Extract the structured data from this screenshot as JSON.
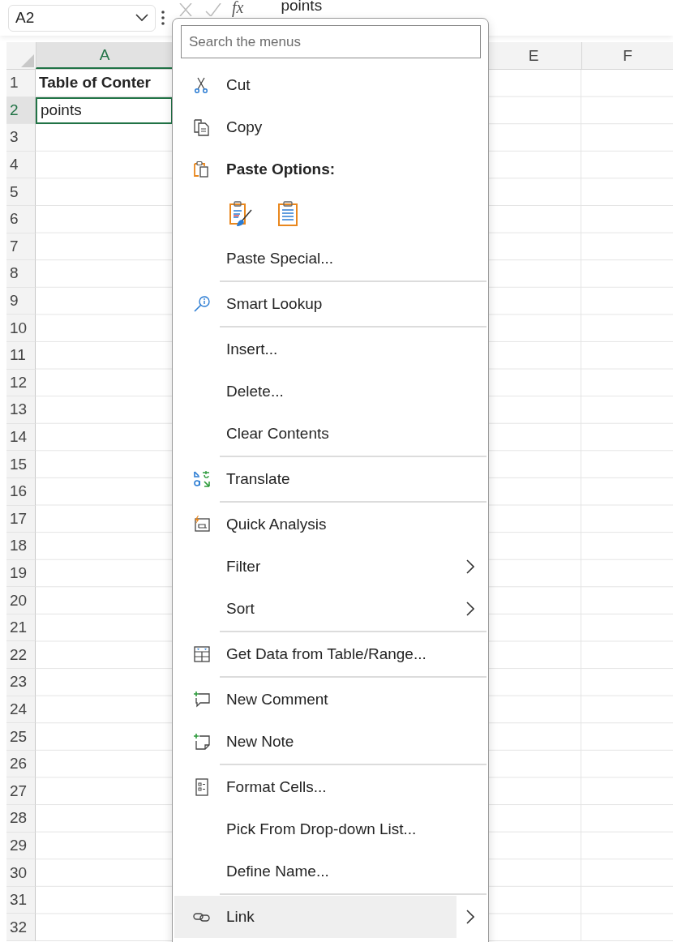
{
  "name_box": {
    "value": "A2"
  },
  "formula_bar": {
    "function_label": "fx",
    "value": "points"
  },
  "columns": [
    {
      "label": "A",
      "selected": true
    },
    {
      "label": "E",
      "selected": false
    },
    {
      "label": "F",
      "selected": false
    }
  ],
  "rows": [
    {
      "number": "1",
      "selected": false,
      "cell": {
        "text": "Table of Conter",
        "bold": true
      }
    },
    {
      "number": "2",
      "selected": true,
      "cell": {
        "text": "points",
        "bold": false
      }
    },
    {
      "number": "3",
      "selected": false
    },
    {
      "number": "4",
      "selected": false
    },
    {
      "number": "5",
      "selected": false
    },
    {
      "number": "6",
      "selected": false
    },
    {
      "number": "7",
      "selected": false
    },
    {
      "number": "8",
      "selected": false
    },
    {
      "number": "9",
      "selected": false
    },
    {
      "number": "10",
      "selected": false
    },
    {
      "number": "11",
      "selected": false
    },
    {
      "number": "12",
      "selected": false
    },
    {
      "number": "13",
      "selected": false
    },
    {
      "number": "14",
      "selected": false
    },
    {
      "number": "15",
      "selected": false
    },
    {
      "number": "16",
      "selected": false
    },
    {
      "number": "17",
      "selected": false
    },
    {
      "number": "18",
      "selected": false
    },
    {
      "number": "19",
      "selected": false
    },
    {
      "number": "20",
      "selected": false
    },
    {
      "number": "21",
      "selected": false
    },
    {
      "number": "22",
      "selected": false
    },
    {
      "number": "23",
      "selected": false
    },
    {
      "number": "24",
      "selected": false
    },
    {
      "number": "25",
      "selected": false
    },
    {
      "number": "26",
      "selected": false
    },
    {
      "number": "27",
      "selected": false
    },
    {
      "number": "28",
      "selected": false
    },
    {
      "number": "29",
      "selected": false
    },
    {
      "number": "30",
      "selected": false
    },
    {
      "number": "31",
      "selected": false
    },
    {
      "number": "32",
      "selected": false
    }
  ],
  "context_menu": {
    "search": {
      "placeholder": "Search the menus"
    },
    "items": [
      {
        "kind": "item",
        "label": "Cut",
        "submenu": false,
        "selected": false
      },
      {
        "kind": "item",
        "label": "Copy",
        "submenu": false,
        "selected": false
      },
      {
        "kind": "header",
        "label": "Paste Options:"
      },
      {
        "kind": "paste-icons"
      },
      {
        "kind": "item",
        "label": "Paste Special...",
        "submenu": false,
        "selected": false
      },
      {
        "kind": "separator"
      },
      {
        "kind": "item",
        "label": "Smart Lookup",
        "submenu": false,
        "selected": false
      },
      {
        "kind": "separator"
      },
      {
        "kind": "item",
        "label": "Insert...",
        "submenu": false,
        "selected": false
      },
      {
        "kind": "item",
        "label": "Delete...",
        "submenu": false,
        "selected": false
      },
      {
        "kind": "item",
        "label": "Clear Contents",
        "submenu": false,
        "selected": false
      },
      {
        "kind": "separator"
      },
      {
        "kind": "item",
        "label": "Translate",
        "submenu": false,
        "selected": false
      },
      {
        "kind": "separator"
      },
      {
        "kind": "item",
        "label": "Quick Analysis",
        "submenu": false,
        "selected": false
      },
      {
        "kind": "item",
        "label": "Filter",
        "submenu": true,
        "selected": false
      },
      {
        "kind": "item",
        "label": "Sort",
        "submenu": true,
        "selected": false
      },
      {
        "kind": "separator"
      },
      {
        "kind": "item",
        "label": "Get Data from Table/Range...",
        "submenu": false,
        "selected": false
      },
      {
        "kind": "separator"
      },
      {
        "kind": "item",
        "label": "New Comment",
        "submenu": false,
        "selected": false
      },
      {
        "kind": "item",
        "label": "New Note",
        "submenu": false,
        "selected": false
      },
      {
        "kind": "separator"
      },
      {
        "kind": "item",
        "label": "Format Cells...",
        "submenu": false,
        "selected": false
      },
      {
        "kind": "item",
        "label": "Pick From Drop-down List...",
        "submenu": false,
        "selected": false
      },
      {
        "kind": "item",
        "label": "Define Name...",
        "submenu": false,
        "selected": false
      },
      {
        "kind": "separator"
      },
      {
        "kind": "item",
        "label": "Link",
        "submenu": true,
        "selected": true
      }
    ]
  }
}
